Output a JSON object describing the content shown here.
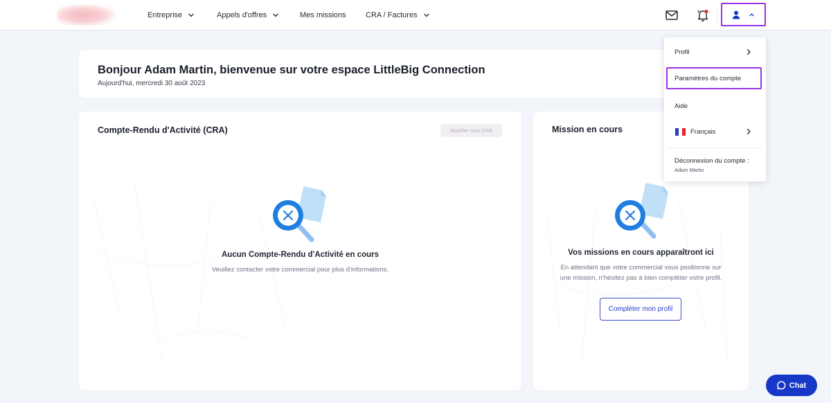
{
  "nav": {
    "items": [
      {
        "label": "Entreprise",
        "has_dropdown": true
      },
      {
        "label": "Appels d'offres",
        "has_dropdown": true
      },
      {
        "label": "Mes missions",
        "has_dropdown": false
      },
      {
        "label": "CRA / Factures",
        "has_dropdown": true
      }
    ],
    "icons": {
      "mail": "mail-icon",
      "notifications": "bell-icon",
      "user": "user-icon",
      "user_toggle": "chevron-up-icon"
    },
    "notification_dot_color": "#e53935"
  },
  "welcome": {
    "title": "Bonjour Adam Martin, bienvenue sur votre espace LittleBig Connection",
    "date": "Aujourd'hui, mercredi 30 août 2023"
  },
  "cra": {
    "title": "Compte-Rendu d'Activité (CRA)",
    "modify_label": "Modifier mon CRA",
    "empty_title": "Aucun Compte-Rendu d'Activité en cours",
    "empty_text": "Veuillez contacter votre commercial pour plus d'informations."
  },
  "mission": {
    "title": "Mission en cours",
    "empty_title": "Vos missions en cours apparaîtront ici",
    "empty_text_line1": "En attendant que votre commercial vous positionne sur",
    "empty_text_line2": "une mission, n'hésitez pas à bien compléter votre profil.",
    "complete_label": "Compléter mon profil"
  },
  "dropdown": {
    "profile": "Profil",
    "account_settings": "Paramètres du compte",
    "help": "Aide",
    "language": "Français",
    "logout_label": "Déconnexion du compte :",
    "logout_user": "Adam Martin"
  },
  "chat": {
    "label": "Chat"
  },
  "colors": {
    "accent": "#1637c8",
    "highlight": "#9b30e8",
    "illustration_blue": "#1e7fe0",
    "illustration_light": "#bfe0f7"
  }
}
